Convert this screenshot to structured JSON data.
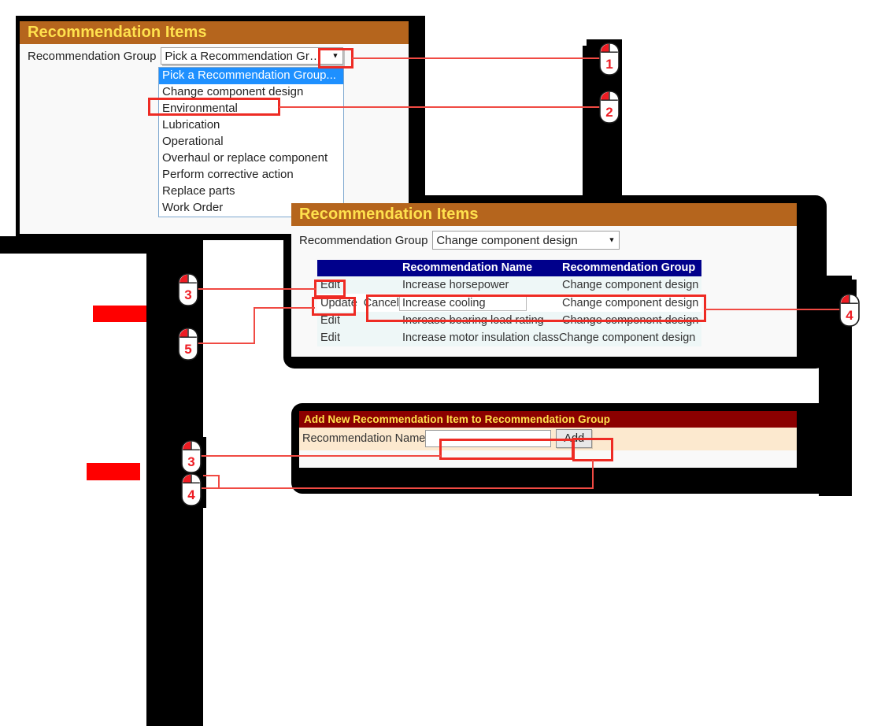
{
  "colors": {
    "panel_header": "#b5651d",
    "panel_header_text": "#ffe14d",
    "add_header": "#8b0000",
    "grid_header": "#00008b",
    "annotation_red": "#ee2b24",
    "redaction_red": "#ff0000",
    "option_selected": "#1e90ff"
  },
  "panel_top": {
    "title": "Recommendation Items",
    "group_label": "Recommendation Group",
    "select": {
      "value": "Pick a Recommendation Group...",
      "caret": "▼",
      "expanded": true,
      "options": [
        "Pick a Recommendation Group...",
        "Change component design",
        "Environmental",
        "Lubrication",
        "Operational",
        "Overhaul or replace component",
        "Perform corrective action",
        "Replace parts",
        "Work Order"
      ],
      "selected_index": 0
    }
  },
  "panel_grid": {
    "title": "Recommendation Items",
    "group_label": "Recommendation Group",
    "select": {
      "value": "Change component design",
      "caret": "▼"
    },
    "table": {
      "headers": [
        "",
        "Recommendation Name",
        "Recommendation Group"
      ],
      "rows": [
        {
          "mode": "view",
          "commands": [
            "Edit"
          ],
          "name": "Increase horsepower",
          "group": "Change component design"
        },
        {
          "mode": "edit",
          "commands": [
            "Update",
            "Cancel"
          ],
          "name": "Increase cooling",
          "group": "Change component design"
        },
        {
          "mode": "view",
          "commands": [
            "Edit"
          ],
          "name": "Increase bearing load rating",
          "group": "Change component design"
        },
        {
          "mode": "view",
          "commands": [
            "Edit"
          ],
          "name": "Increase motor insulation class",
          "group": "Change component design"
        }
      ]
    }
  },
  "panel_add": {
    "title": "Add New Recommendation Item to Recommendation Group",
    "name_label": "Recommendation Name",
    "name_value": "",
    "name_placeholder": "",
    "add_button": "Add"
  },
  "callouts": [
    {
      "id": "c1",
      "number": "1"
    },
    {
      "id": "c2",
      "number": "2"
    },
    {
      "id": "c3a",
      "number": "3"
    },
    {
      "id": "c5",
      "number": "5"
    },
    {
      "id": "c4a",
      "number": "4"
    },
    {
      "id": "c3b",
      "number": "3"
    },
    {
      "id": "c4b",
      "number": "4"
    }
  ]
}
